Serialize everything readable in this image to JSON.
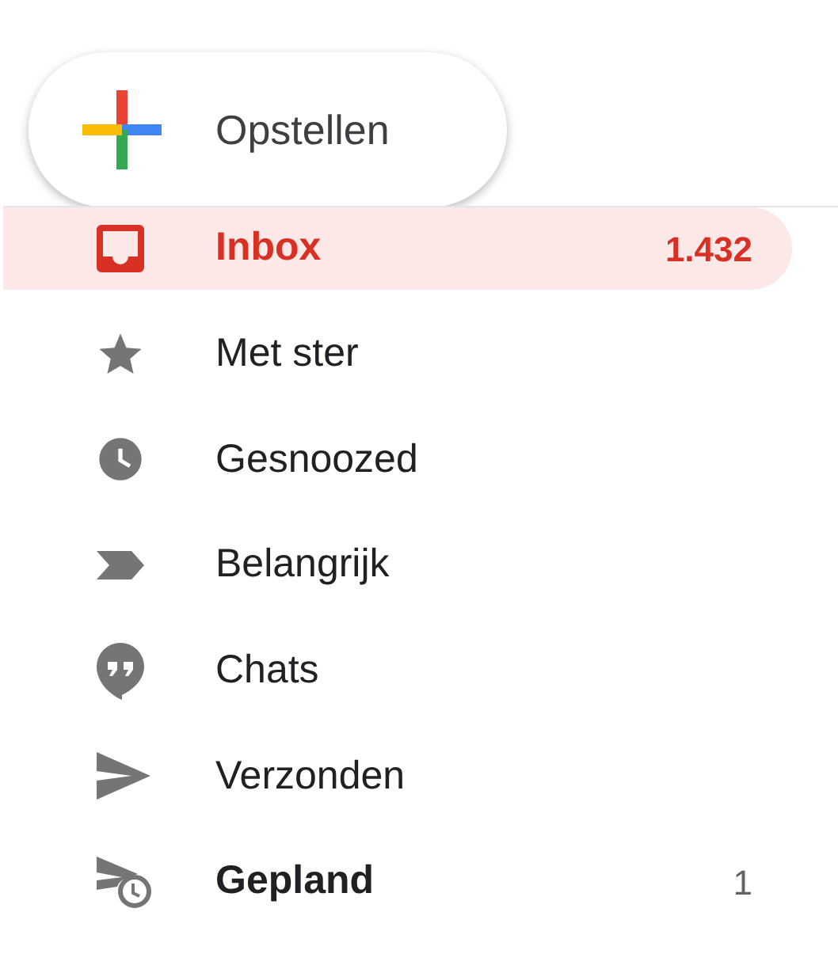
{
  "compose_button": {
    "label": "Opstellen"
  },
  "nav_items": [
    {
      "kind": "inbox",
      "label": "Inbox",
      "count": "1.432",
      "selected": true,
      "unread": true
    },
    {
      "kind": "star",
      "label": "Met ster",
      "selected": false,
      "unread": false
    },
    {
      "kind": "clock",
      "label": "Gesnoozed",
      "selected": false,
      "unread": false
    },
    {
      "kind": "label",
      "label": "Belangrijk",
      "selected": false,
      "unread": false
    },
    {
      "kind": "chat",
      "label": "Chats",
      "selected": false,
      "unread": false
    },
    {
      "kind": "send",
      "label": "Verzonden",
      "selected": false,
      "unread": false
    },
    {
      "kind": "scheduled",
      "label": "Gepland",
      "count": "1",
      "selected": false,
      "unread": true
    }
  ]
}
